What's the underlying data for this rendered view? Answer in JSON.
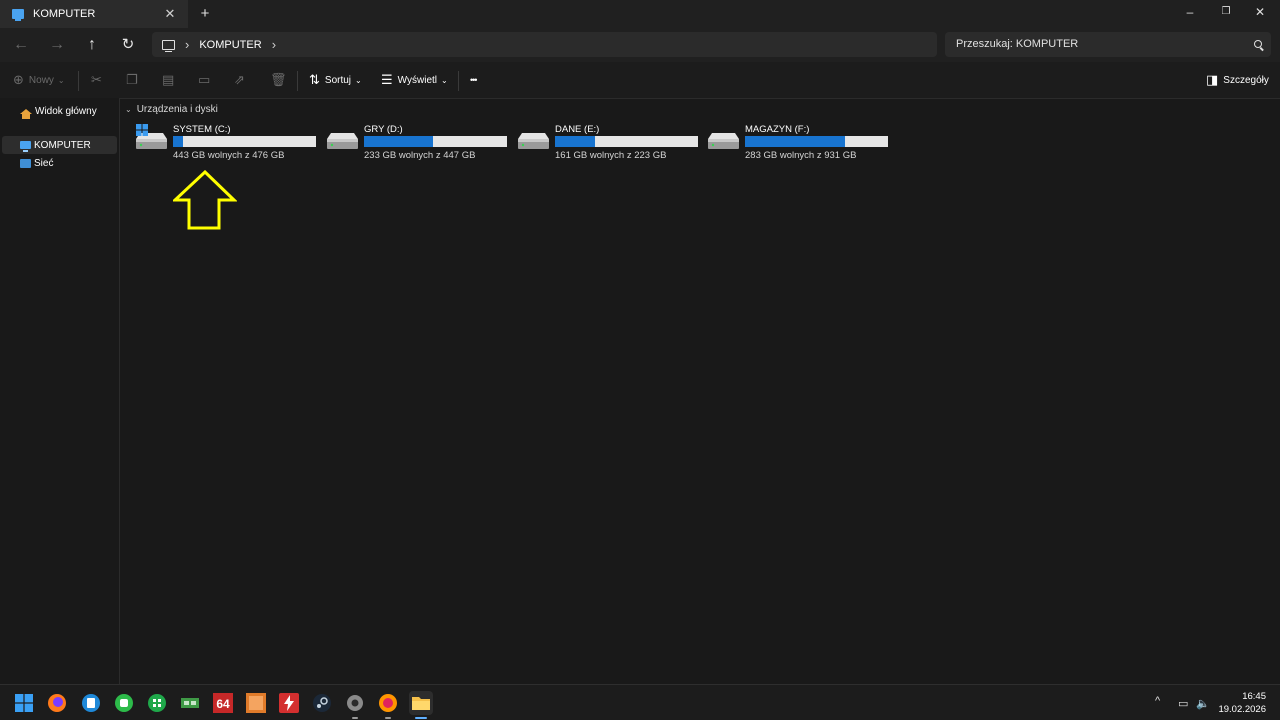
{
  "window": {
    "tab_title": "KOMPUTER",
    "tab_close_glyph": "✕",
    "tab_add_glyph": "+",
    "minimize_glyph": "–",
    "maximize_glyph": "❐",
    "close_glyph": "✕"
  },
  "nav": {
    "back_glyph": "←",
    "forward_glyph": "→",
    "up_glyph": "↑",
    "refresh_glyph": "↻",
    "breadcrumb": [
      "KOMPUTER"
    ],
    "chevron": "›",
    "search_placeholder": "Przeszukaj: KOMPUTER"
  },
  "commands": {
    "new_label": "Nowy",
    "sort_label": "Sortuj",
    "view_label": "Wyświetl",
    "more_glyph": "•••",
    "details_label": "Szczegóły"
  },
  "sidebar": {
    "items": [
      {
        "label": "Widok główny",
        "icon": "home-icon"
      },
      {
        "label": "KOMPUTER",
        "icon": "computer-icon",
        "selected": true
      },
      {
        "label": "Sieć",
        "icon": "network-icon"
      }
    ]
  },
  "content": {
    "group_title": "Urządzenia i dyski",
    "drives": [
      {
        "name": "SYSTEM (C:)",
        "free_text": "443 GB wolnych z 476 GB",
        "used_fraction": 0.07,
        "system": true
      },
      {
        "name": "GRY (D:)",
        "free_text": "233 GB wolnych z 447 GB",
        "used_fraction": 0.48
      },
      {
        "name": "DANE (E:)",
        "free_text": "161 GB wolnych z 223 GB",
        "used_fraction": 0.28
      },
      {
        "name": "MAGAZYN (F:)",
        "free_text": "283 GB wolnych z 931 GB",
        "used_fraction": 0.7
      }
    ]
  },
  "taskbar": {
    "time": "16:45",
    "date": "19.02.2026",
    "tray_up_glyph": "^",
    "apps": [
      "start-icon",
      "firefox-icon",
      "app-blue-icon",
      "app-green-icon",
      "app-grid-icon",
      "network-card-icon",
      "aida64-icon",
      "cpu-z-icon",
      "flash-icon",
      "steam-icon",
      "settings-icon",
      "firefox-alt-icon",
      "file-explorer-icon"
    ]
  },
  "colors": {
    "accent": "#1874d0",
    "bar_bg": "#e6e6e6",
    "annotation_arrow": "#ffff00"
  }
}
